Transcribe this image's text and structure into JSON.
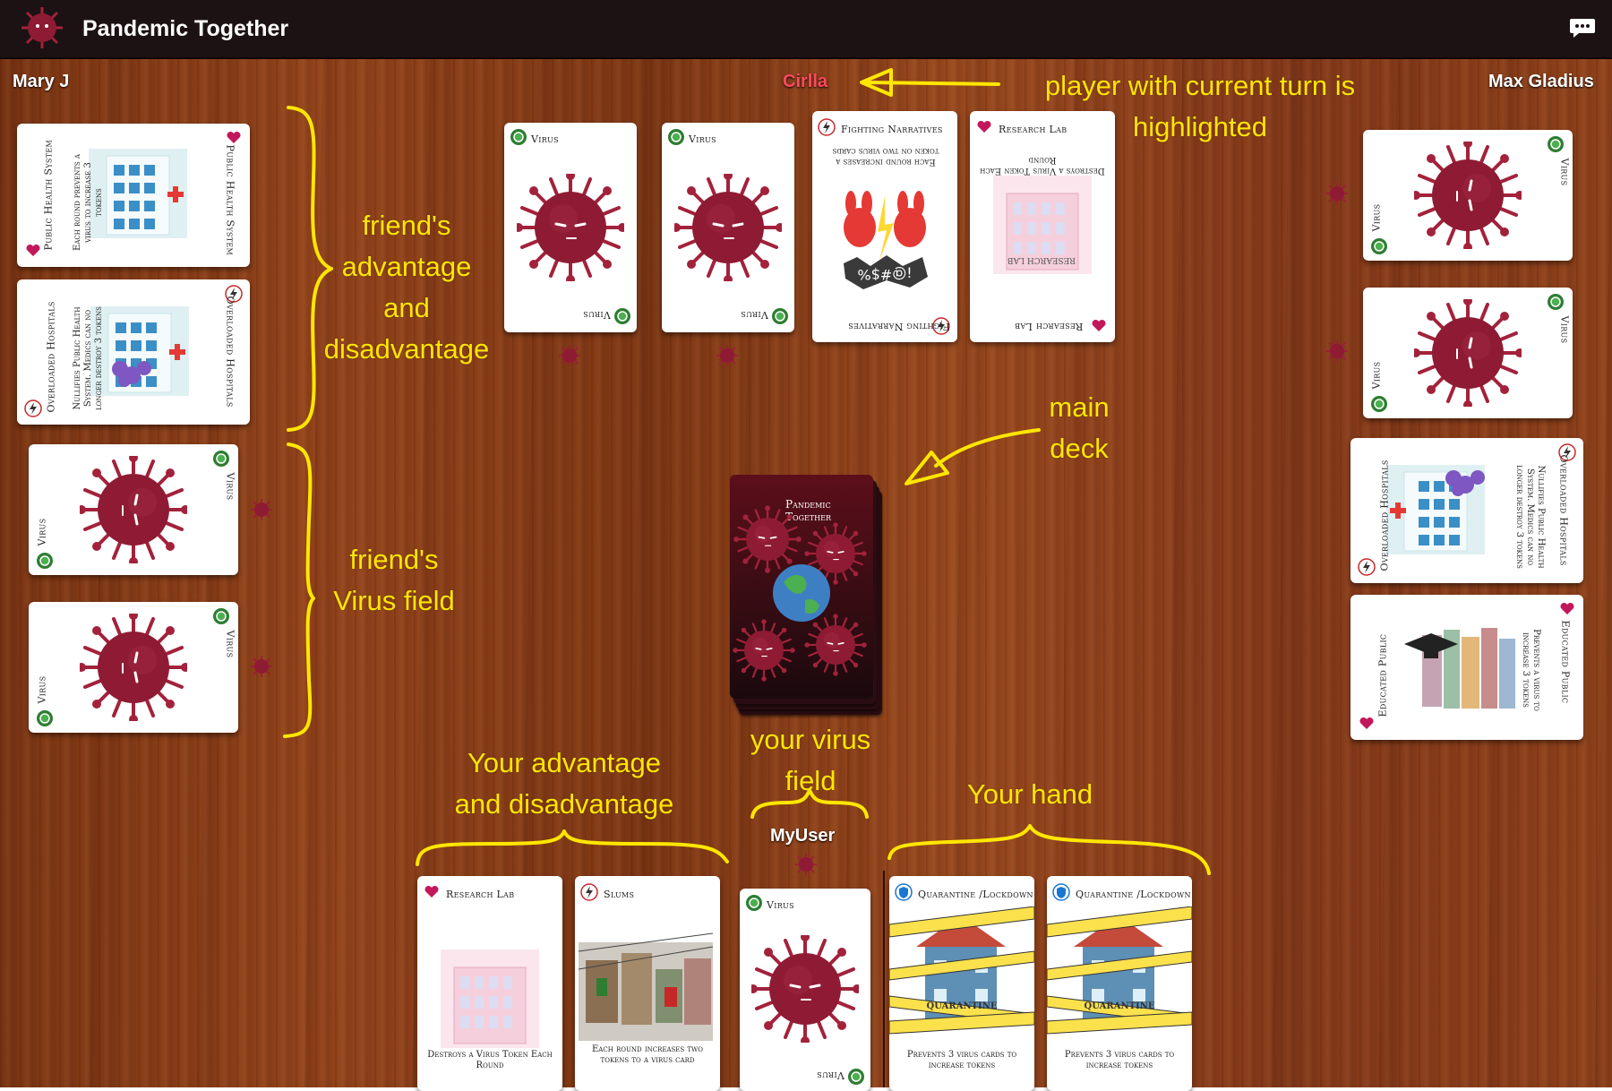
{
  "app": {
    "title": "Pandemic Together",
    "logo_icon": "virus-logo-icon",
    "chat_icon": "chat-bubble-icon"
  },
  "players": {
    "left": "Mary J",
    "top": "Cirlla",
    "right": "Max Gladius",
    "me": "MyUser",
    "active": "Cirlla"
  },
  "cards": {
    "public_health": {
      "title": "Public Health System",
      "desc": "Each round prevents a virus to increase 3 tokens"
    },
    "overloaded": {
      "title": "Overloaded Hospitals",
      "desc": "Nullifies Public Health System. Medics can no longer destroy 3 tokens"
    },
    "virus": {
      "title": "Virus"
    },
    "fighting": {
      "title": "Fighting Narratives",
      "desc": "Each round increases a token on two virus cards",
      "speech": "¡@#$%"
    },
    "research": {
      "title": "Research Lab",
      "desc": "Destroys a Virus Token Each Round",
      "art_label": "RESEARCH LAB"
    },
    "educated": {
      "title": "Educated Public",
      "desc": "Prevents a virus to increase 3 tokens"
    },
    "slums": {
      "title": "Slums",
      "desc": "Each round increases two tokens to a virus card"
    },
    "quarantine": {
      "title": "Quarantine /Lockdown",
      "desc": "Prevents 3 virus cards to increase tokens",
      "tape": "QUARANTINE"
    },
    "deck": {
      "title": "Pandemic Together"
    }
  },
  "annotations": {
    "turn_line1": "player with current turn is",
    "turn_line2": "highlighted",
    "friend_adv": [
      "friend's",
      "advantage",
      "and",
      "disadvantage"
    ],
    "friend_virus": [
      "friend's",
      "Virus field"
    ],
    "main_deck": [
      "main",
      "deck"
    ],
    "your_adv": [
      "Your advantage",
      "and disadvantage"
    ],
    "your_virus": [
      "your virus",
      "field"
    ],
    "your_hand": "Your hand"
  },
  "colors": {
    "accent": "#ffe600",
    "active_player": "#ff4a5e",
    "virus": "#8e1b33",
    "topbar": "#1c1214"
  }
}
